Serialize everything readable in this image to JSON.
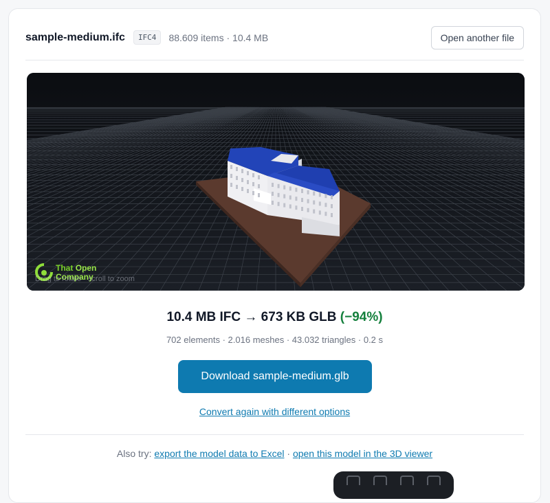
{
  "header": {
    "filename": "sample-medium.ifc",
    "format_badge": "IFC4",
    "meta": "88.609 items · 10.4 MB",
    "open_button_label": "Open another file"
  },
  "viewer": {
    "logo_line1_prefix": "That",
    "logo_line1_accent": "Open",
    "logo_line2": "Company",
    "hint": "Drag to rotate · scroll to zoom",
    "colors": {
      "background": "#0e1116",
      "grid": "#4a5059",
      "roof": "#1f3fb0",
      "walls": "#e8e8ec",
      "ground": "#5b3a2e"
    }
  },
  "result": {
    "summary": "10.4 MB IFC → 673 KB GLB",
    "reduction": "(−94%)",
    "stats": "702 elements · 2.016 meshes · 43.032 triangles · 0.2 s"
  },
  "actions": {
    "download_label": "Download sample-medium.glb",
    "convert_again_label": "Convert again with different options"
  },
  "also_try": {
    "prefix": "Also try:",
    "link1": "export the model data to Excel",
    "separator": "·",
    "link2": "open this model in the 3D viewer"
  },
  "colors": {
    "accent": "#0e7ab0",
    "success": "#15803d"
  }
}
